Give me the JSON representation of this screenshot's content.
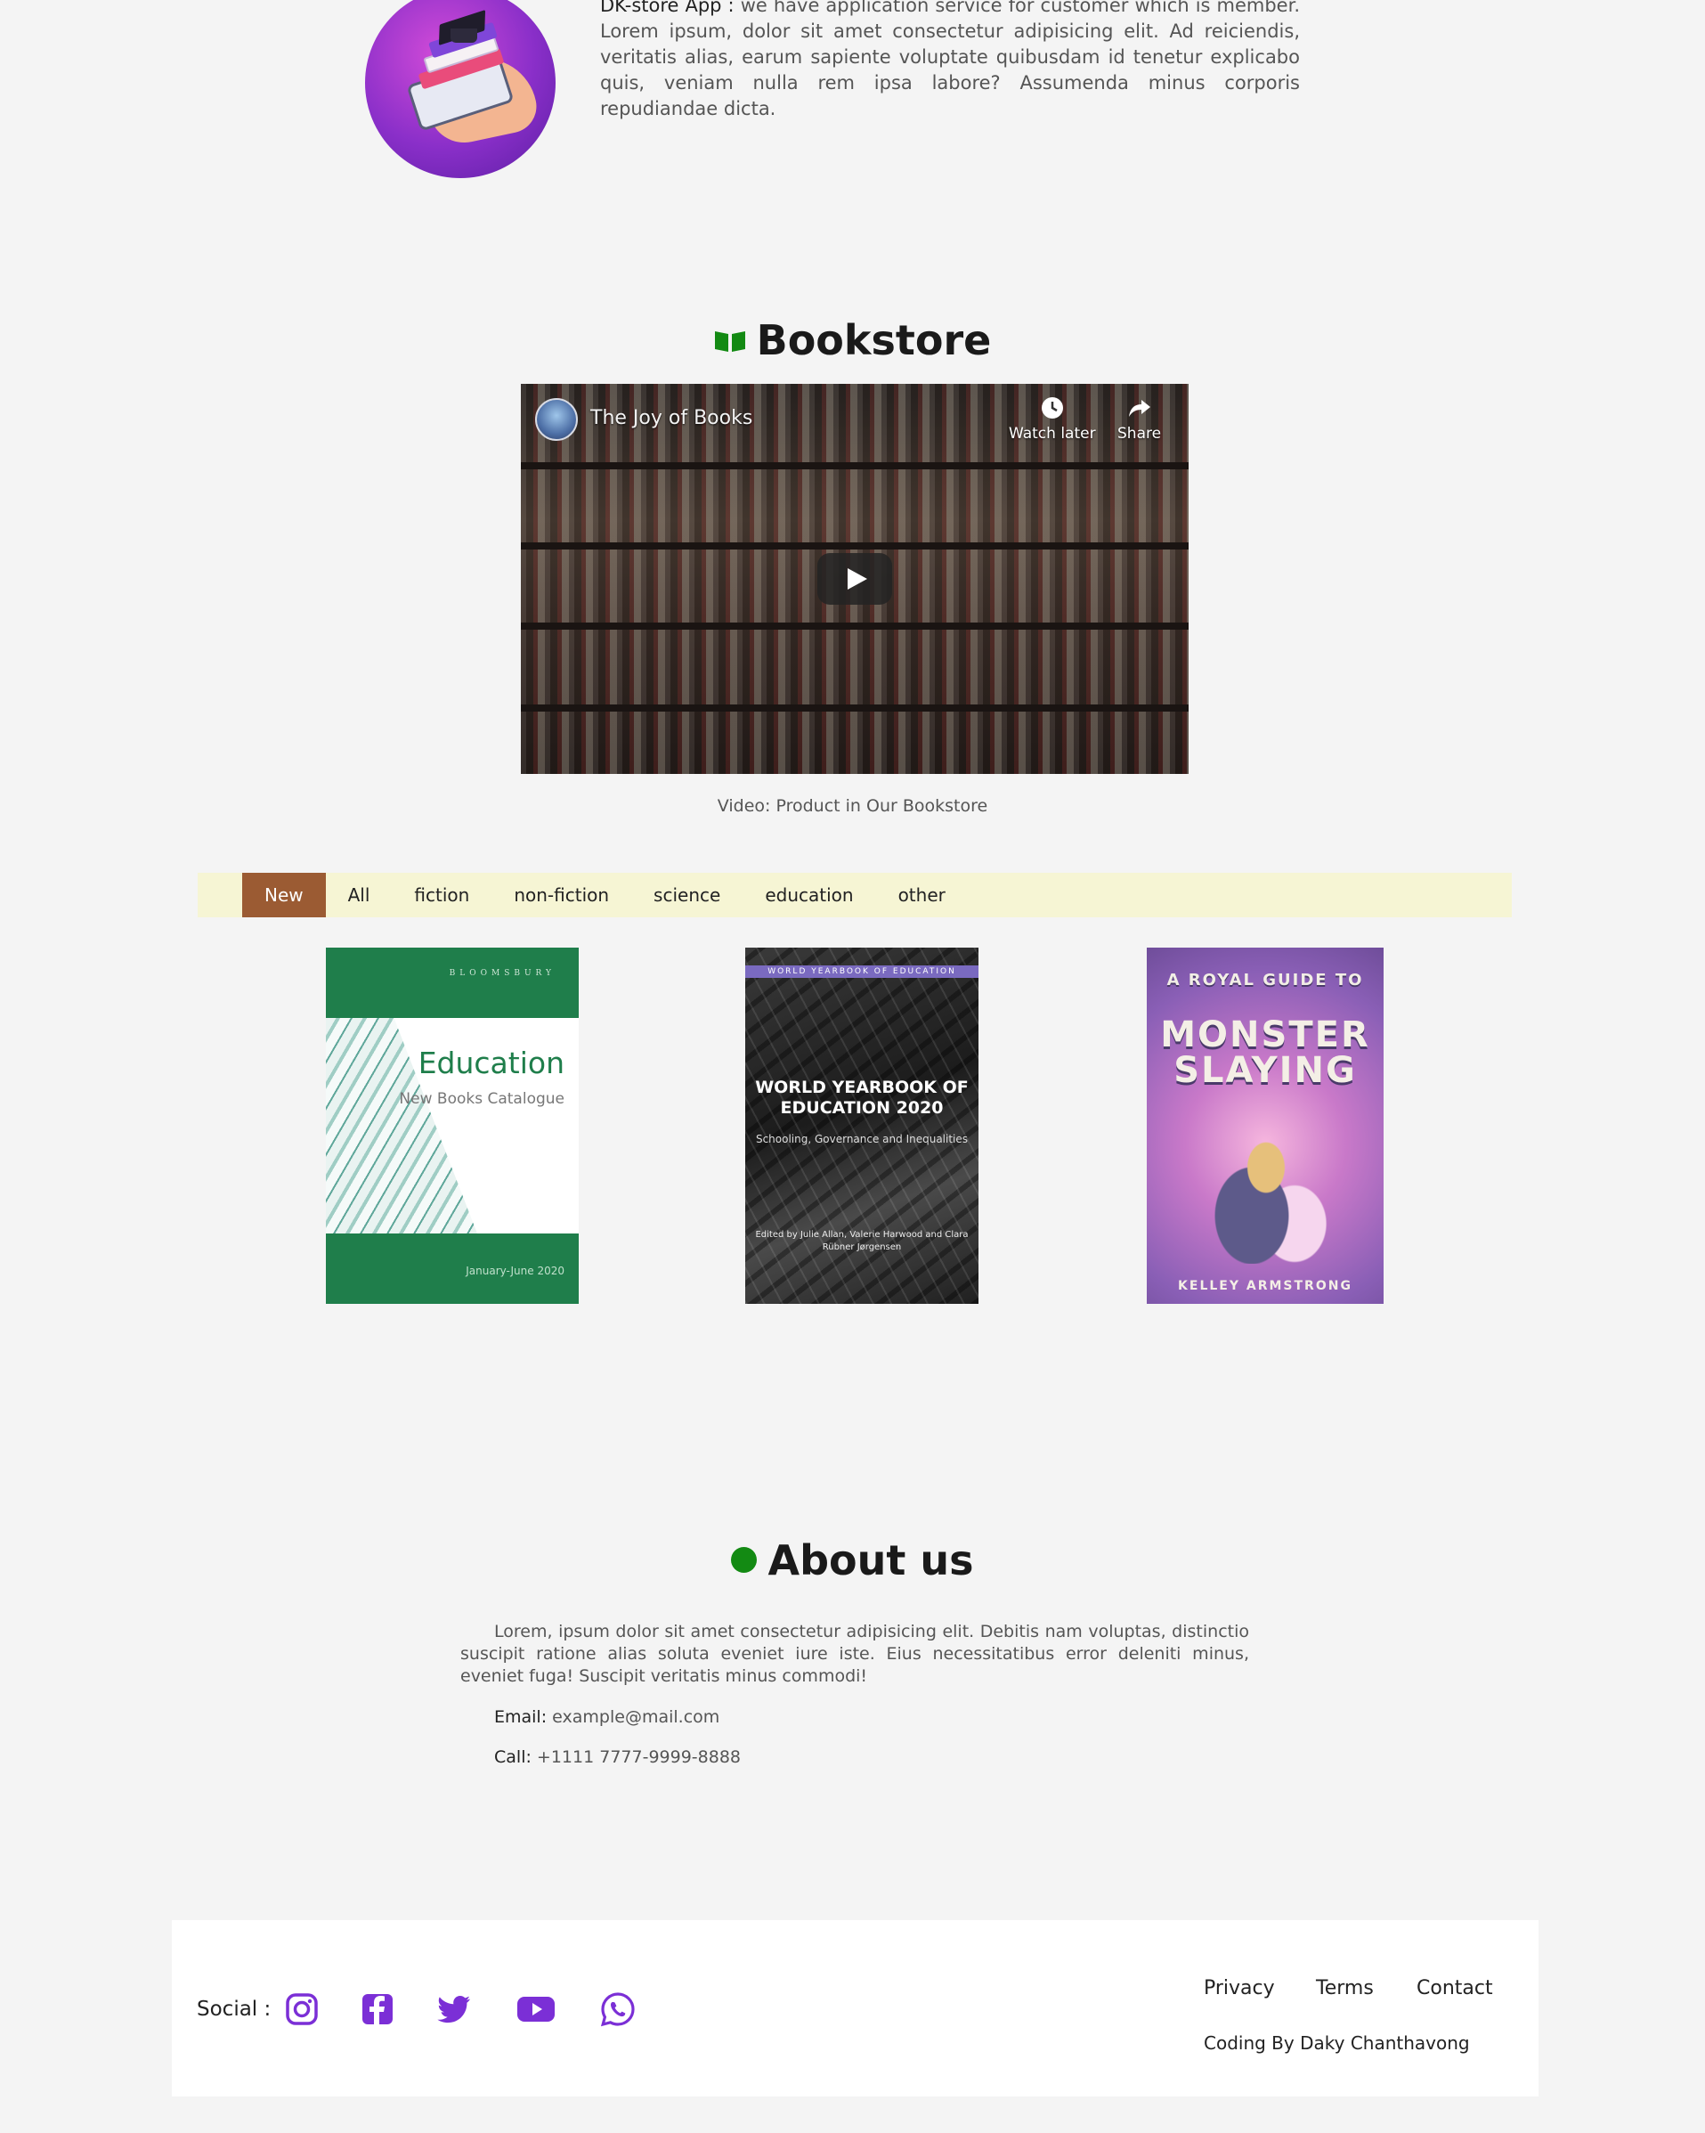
{
  "app": {
    "name": "DK-store App :",
    "text": "we have application service for customer which is member. Lorem ipsum, dolor sit amet consectetur adipisicing elit. Ad reiciendis, veritatis alias, earum sapiente voluptate quibusdam id tenetur explicabo quis, veniam nulla rem ipsa labore? Assumenda minus corporis repudiandae dicta."
  },
  "bookstore": {
    "title": "Bookstore",
    "title_icon": "open-book-icon",
    "video": {
      "title": "The Joy of Books",
      "watch_later": "Watch later",
      "share": "Share"
    },
    "caption": "Video: Product in Our Bookstore"
  },
  "filters": {
    "items": [
      "New",
      "All",
      "fiction",
      "non-fiction",
      "science",
      "education",
      "other"
    ],
    "active": "New",
    "active_color": "#9b5b33",
    "bar_color": "#f6f5d4"
  },
  "books": [
    {
      "publisher": "BLOOMSBURY",
      "title": "Education",
      "subtitle": "New Books Catalogue",
      "date": "January-June 2020",
      "accent": "#1f7e4b"
    },
    {
      "series": "WORLD YEARBOOK OF EDUCATION",
      "title": "WORLD YEARBOOK OF EDUCATION 2020",
      "subtitle": "Schooling, Governance and Inequalities",
      "editors": "Edited by Julie Allan, Valerie Harwood and Clara Rübner Jørgensen"
    },
    {
      "pre": "A ROYAL GUIDE TO",
      "title": "MONSTER SLAYING",
      "author": "KELLEY ARMSTRONG"
    }
  ],
  "about": {
    "title": "About us",
    "text": "Lorem, ipsum dolor sit amet consectetur adipisicing elit. Debitis nam voluptas, distinctio suscipit ratione alias soluta eveniet iure iste. Eius necessitatibus error deleniti minus, eveniet fuga! Suscipit veritatis minus commodi!",
    "email_label": "Email:",
    "email": "example@mail.com",
    "call_label": "Call:",
    "phone": "+1111 7777-9999-8888",
    "dot_color": "#138a13"
  },
  "footer": {
    "social_label": "Social :",
    "social_icons": [
      "instagram-icon",
      "facebook-icon",
      "twitter-icon",
      "youtube-icon",
      "whatsapp-icon"
    ],
    "icon_color": "#7b2fd6",
    "links": [
      "Privacy",
      "Terms",
      "Contact"
    ],
    "credit": "Coding By Daky Chanthavong"
  }
}
